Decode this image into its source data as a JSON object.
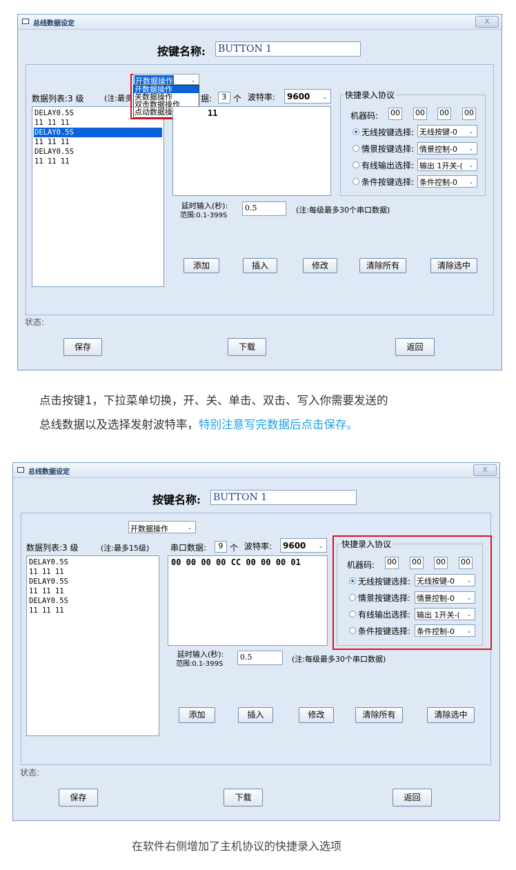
{
  "window_title": "总线数据设定",
  "close_label": "X",
  "button_name_label": "按键名称:",
  "button_name_value": "BUTTON 1",
  "operation_select": "开数据操作",
  "operation_options": [
    "开数据操作",
    "关数据操作",
    "双击数据操作",
    "点动数据操作"
  ],
  "data_list_label": "数据列表:3  级",
  "data_list_note": "(注:最多15级)",
  "data_list_note_partial": "(注:最多",
  "data_list_items": [
    "DELAY0.5S",
    "11 11 11",
    "DELAY0.5S",
    "11 11 11",
    "DELAY0.5S",
    "11 11 11"
  ],
  "serial_data_label": "串口数据:",
  "serial_data_label_partial": "据:",
  "serial_count_1": "3",
  "serial_count_2": "9",
  "serial_unit": "个",
  "baud_label": "波特率:",
  "baud_value": "9600",
  "serial_content_1": "11",
  "serial_content_2": "00 00 00 00 CC 00 00 00 01",
  "delay_label_line1": "延时输入(秒):",
  "delay_label_line2": "范围:0.1-399S",
  "delay_value": "0.5",
  "delay_note": "(注:每级最多30个串口数据)",
  "buttons": {
    "add": "添加",
    "insert": "插入",
    "modify": "修改",
    "clear_all": "清除所有",
    "clear_selected": "清除选中"
  },
  "quick": {
    "group_title": "快捷录入协议",
    "machine_code_label": "机器码:",
    "machine_codes": [
      "00",
      "00",
      "00",
      "00"
    ],
    "rows": [
      {
        "label": "无线按键选择:",
        "value": "无线按键-0"
      },
      {
        "label": "情景按键选择:",
        "value": "情景控制-0"
      },
      {
        "label": "有线输出选择:",
        "value": "输出 1开关-("
      },
      {
        "label": "条件按键选择:",
        "value": "条件控制-0"
      }
    ]
  },
  "status_label": "状态:",
  "footer": {
    "save": "保存",
    "download": "下载",
    "back": "返回"
  },
  "paragraph_line1": "点击按键1，下拉菜单切换，开、关、单击、双击、写入你需要发送的",
  "paragraph_line2_a": "总线数据以及选择发射波特率，",
  "paragraph_line2_b": "特别注意写完数据后点击保存。",
  "caption": "在软件右侧增加了主机协议的快捷录入选项",
  "colors": {
    "window_bg": "#dfe9f5",
    "selection": "#0a63d8",
    "highlight_box": "#e0101a",
    "accent_text": "#1ea0e6"
  }
}
